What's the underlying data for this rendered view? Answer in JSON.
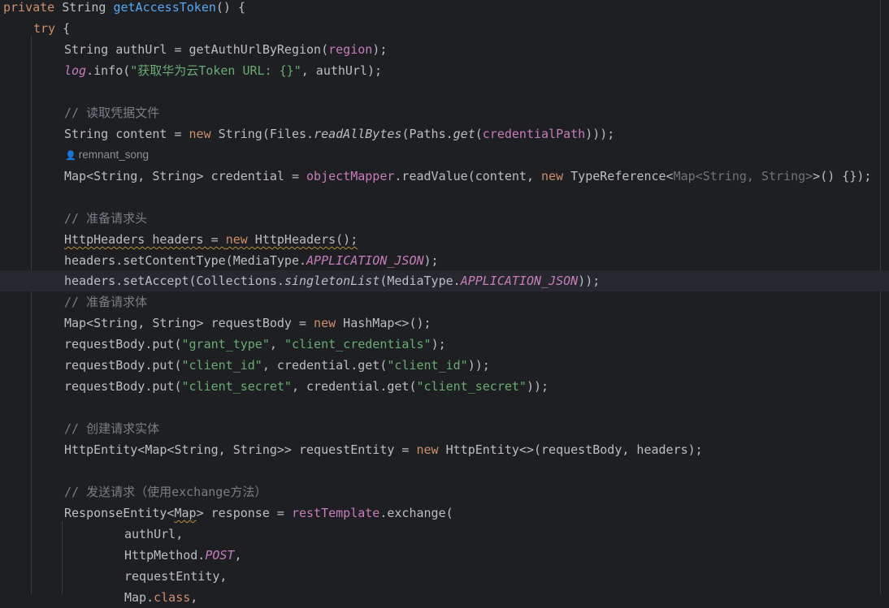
{
  "editor": {
    "author_hint": "remnant_song",
    "lines": {
      "l1": {
        "p1": "private",
        "p2": " String ",
        "p3": "getAccessToken",
        "p4": "() {"
      },
      "l2": {
        "p1": "try",
        "p2": " {"
      },
      "l3": {
        "p1": "String authUrl = getAuthUrlByRegion(",
        "p2": "region",
        "p3": ");"
      },
      "l4": {
        "p1": "log",
        "p2": ".info(",
        "p3": "\"获取华为云Token URL: {}\"",
        "p4": ", authUrl);"
      },
      "l6": {
        "p1": "// 读取凭据文件"
      },
      "l7": {
        "p1": "String content = ",
        "p2": "new",
        "p3": " String(Files.",
        "p4": "readAllBytes",
        "p5": "(Paths.",
        "p6": "get",
        "p7": "(",
        "p8": "credentialPath",
        "p9": ")));"
      },
      "l9": {
        "p1": "Map<String, String> credential = ",
        "p2": "objectMapper",
        "p3": ".readValue(content, ",
        "p4": "new",
        "p5": " TypeReference<",
        "p6": "Map<String, String>",
        "p7": ">() {});"
      },
      "l11": {
        "p1": "// 准备请求头"
      },
      "l12": {
        "p1": "HttpHeaders headers = ",
        "p2": "new",
        "p3": " HttpHeaders();"
      },
      "l13": {
        "p1": "headers.setContentType(MediaType.",
        "p2": "APPLICATION_JSON",
        "p3": ");"
      },
      "l14": {
        "p1": "headers.setAccept(Collections.",
        "p2": "singletonList",
        "p3": "(MediaType.",
        "p4": "APPLICATION_JSON",
        "p5": "));"
      },
      "l15": {
        "p1": "// 准备请求体"
      },
      "l16": {
        "p1": "Map<String, String> requestBody = ",
        "p2": "new",
        "p3": " HashMap<>();"
      },
      "l17": {
        "p1": "requestBody.put(",
        "p2": "\"grant_type\"",
        "p3": ", ",
        "p4": "\"client_credentials\"",
        "p5": ");"
      },
      "l18": {
        "p1": "requestBody.put(",
        "p2": "\"client_id\"",
        "p3": ", credential.get(",
        "p4": "\"client_id\"",
        "p5": "));"
      },
      "l19": {
        "p1": "requestBody.put(",
        "p2": "\"client_secret\"",
        "p3": ", credential.get(",
        "p4": "\"client_secret\"",
        "p5": "));"
      },
      "l21": {
        "p1": "// 创建请求实体"
      },
      "l22": {
        "p1": "HttpEntity<Map<String, String>> requestEntity = ",
        "p2": "new",
        "p3": " HttpEntity<>(requestBody, headers);"
      },
      "l24": {
        "p1": "// 发送请求（使用exchange方法）"
      },
      "l25": {
        "p1": "ResponseEntity<",
        "p2": "Map",
        "p3": "> response = ",
        "p4": "restTemplate",
        "p5": ".exchange("
      },
      "l26": {
        "p1": "authUrl,"
      },
      "l27": {
        "p1": "HttpMethod.",
        "p2": "POST",
        "p3": ","
      },
      "l28": {
        "p1": "requestEntity,"
      },
      "l29": {
        "p1": "Map.",
        "p2": "class",
        "p3": ","
      }
    }
  },
  "colors": {
    "background": "#1e1f22",
    "keyword": "#cf8e6d",
    "method_declaration": "#56a8f5",
    "string": "#6aab73",
    "comment": "#7a7e85",
    "field": "#c77dbb",
    "default_text": "#bcbec4"
  }
}
